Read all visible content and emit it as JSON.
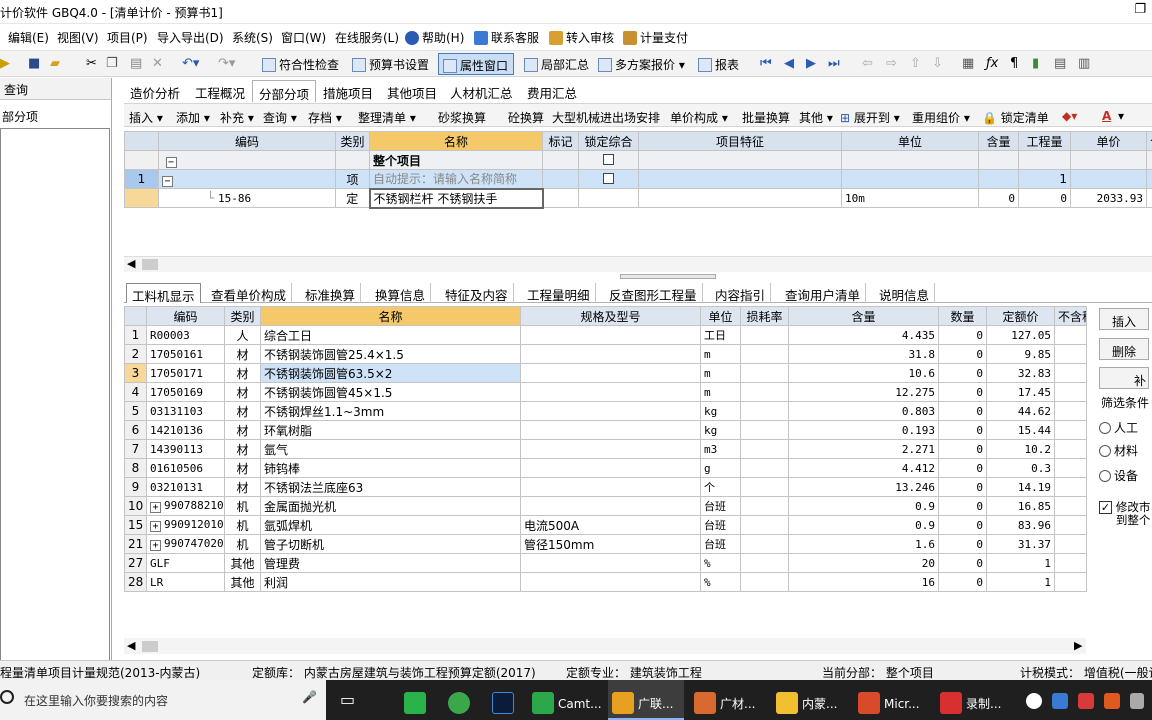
{
  "window": {
    "title": "计价软件 GBQ4.0 - [清单计价 - 预算书1]"
  },
  "menu": [
    "编辑(E)",
    "视图(V)",
    "项目(P)",
    "导入导出(D)",
    "系统(S)",
    "窗口(W)",
    "在线服务(L)",
    "帮助(H)",
    "联系客服",
    "转入审核",
    "计量支付"
  ],
  "toolbar": {
    "conformity_check": "符合性检查",
    "budget_settings": "预算书设置",
    "property_window": "属性窗口",
    "partial_summary": "局部汇总",
    "multi_plan_quote": "多方案报价",
    "report": "报表"
  },
  "left_panel": {
    "header": "查询",
    "item": "部分项"
  },
  "main_tabs": [
    "造价分析",
    "工程概况",
    "分部分项",
    "措施项目",
    "其他项目",
    "人材机汇总",
    "费用汇总"
  ],
  "sub_toolbar": [
    "插入",
    "添加",
    "补充",
    "查询",
    "存档",
    "整理清单",
    "砂浆换算",
    "砼换算",
    "大型机械进出场安排",
    "单价构成",
    "批量换算",
    "其他",
    "展开到",
    "重用组价",
    "锁定清单"
  ],
  "grid1": {
    "headers": [
      "编码",
      "类别",
      "名称",
      "标记",
      "锁定综合",
      "项目特征",
      "单位",
      "含量",
      "工程量",
      "单价",
      "合"
    ],
    "rows": [
      {
        "no": "",
        "code": "",
        "type": "",
        "name": "整个项目",
        "feature": "",
        "unit": "",
        "content": "",
        "qty": "",
        "price": ""
      },
      {
        "no": "1",
        "code": "",
        "type": "项",
        "name": "自动提示：请输入名称简称",
        "feature": "",
        "unit": "",
        "content": "",
        "qty": "1",
        "price": ""
      },
      {
        "no": "",
        "code": "15-86",
        "type": "定",
        "name": "不锈钢栏杆 不锈钢扶手",
        "feature": "",
        "unit": "10m",
        "content": "0",
        "qty": "0",
        "price": "2033.93"
      }
    ]
  },
  "bottom_tabs": [
    "工料机显示",
    "查看单价构成",
    "标准换算",
    "换算信息",
    "特征及内容",
    "工程量明细",
    "反查图形工程量",
    "内容指引",
    "查询用户清单",
    "说明信息"
  ],
  "grid2": {
    "headers": [
      "编码",
      "类别",
      "名称",
      "规格及型号",
      "单位",
      "损耗率",
      "含量",
      "数量",
      "定额价",
      "不含税"
    ],
    "rows": [
      {
        "no": "1",
        "code": "R00003",
        "type": "人",
        "name": "综合工日",
        "spec": "",
        "unit": "工日",
        "content": "4.435",
        "qty": "0",
        "price": "127.05"
      },
      {
        "no": "2",
        "code": "17050161",
        "type": "材",
        "name": "不锈钢装饰圆管25.4×1.5",
        "spec": "",
        "unit": "m",
        "content": "31.8",
        "qty": "0",
        "price": "9.85"
      },
      {
        "no": "3",
        "code": "17050171",
        "type": "材",
        "name": "不锈钢装饰圆管63.5×2",
        "spec": "",
        "unit": "m",
        "content": "10.6",
        "qty": "0",
        "price": "32.83"
      },
      {
        "no": "4",
        "code": "17050169",
        "type": "材",
        "name": "不锈钢装饰圆管45×1.5",
        "spec": "",
        "unit": "m",
        "content": "12.275",
        "qty": "0",
        "price": "17.45"
      },
      {
        "no": "5",
        "code": "03131103",
        "type": "材",
        "name": "不锈钢焊丝1.1~3mm",
        "spec": "",
        "unit": "kg",
        "content": "0.803",
        "qty": "0",
        "price": "44.62"
      },
      {
        "no": "6",
        "code": "14210136",
        "type": "材",
        "name": "环氧树脂",
        "spec": "",
        "unit": "kg",
        "content": "0.193",
        "qty": "0",
        "price": "15.44"
      },
      {
        "no": "7",
        "code": "14390113",
        "type": "材",
        "name": "氩气",
        "spec": "",
        "unit": "m3",
        "content": "2.271",
        "qty": "0",
        "price": "10.2"
      },
      {
        "no": "8",
        "code": "01610506",
        "type": "材",
        "name": "铈钨棒",
        "spec": "",
        "unit": "g",
        "content": "4.412",
        "qty": "0",
        "price": "0.3"
      },
      {
        "no": "9",
        "code": "03210131",
        "type": "材",
        "name": "不锈钢法兰底座63",
        "spec": "",
        "unit": "个",
        "content": "13.246",
        "qty": "0",
        "price": "14.19"
      },
      {
        "no": "10",
        "code": "990788210",
        "type": "机",
        "name": "金属面抛光机",
        "spec": "",
        "unit": "台班",
        "content": "0.9",
        "qty": "0",
        "price": "16.85"
      },
      {
        "no": "15",
        "code": "990912010",
        "type": "机",
        "name": "氩弧焊机",
        "spec": "电流500A",
        "unit": "台班",
        "content": "0.9",
        "qty": "0",
        "price": "83.96"
      },
      {
        "no": "21",
        "code": "990747020",
        "type": "机",
        "name": "管子切断机",
        "spec": "管径150mm",
        "unit": "台班",
        "content": "1.6",
        "qty": "0",
        "price": "31.37"
      },
      {
        "no": "27",
        "code": "GLF",
        "type": "其他",
        "name": "管理费",
        "spec": "",
        "unit": "%",
        "content": "20",
        "qty": "0",
        "price": "1"
      },
      {
        "no": "28",
        "code": "LR",
        "type": "其他",
        "name": "利润",
        "spec": "",
        "unit": "%",
        "content": "16",
        "qty": "0",
        "price": "1"
      }
    ]
  },
  "right_panel": {
    "insert": "插入",
    "delete": "删除",
    "supplement": "补",
    "filter": "筛选条件",
    "labor": "人工",
    "material": "材料",
    "equipment": "设备",
    "modify_line1": "修改市",
    "modify_line2": "到整个"
  },
  "status": {
    "spec": "程量清单项目计量规范(2013-内蒙古)",
    "quota_lib": "定额库：  内蒙古房屋建筑与装饰工程预算定额(2017)",
    "quota_major": "定额专业：  建筑装饰工程",
    "current_part": "当前分部：  整个项目",
    "tax_mode": "计税模式：  增值税(一般计"
  },
  "taskbar": {
    "search_placeholder": "在这里输入你要搜索的内容",
    "apps": [
      "Camt...",
      "广联...",
      "广材...",
      "内蒙...",
      "Micr...",
      "录制..."
    ]
  }
}
